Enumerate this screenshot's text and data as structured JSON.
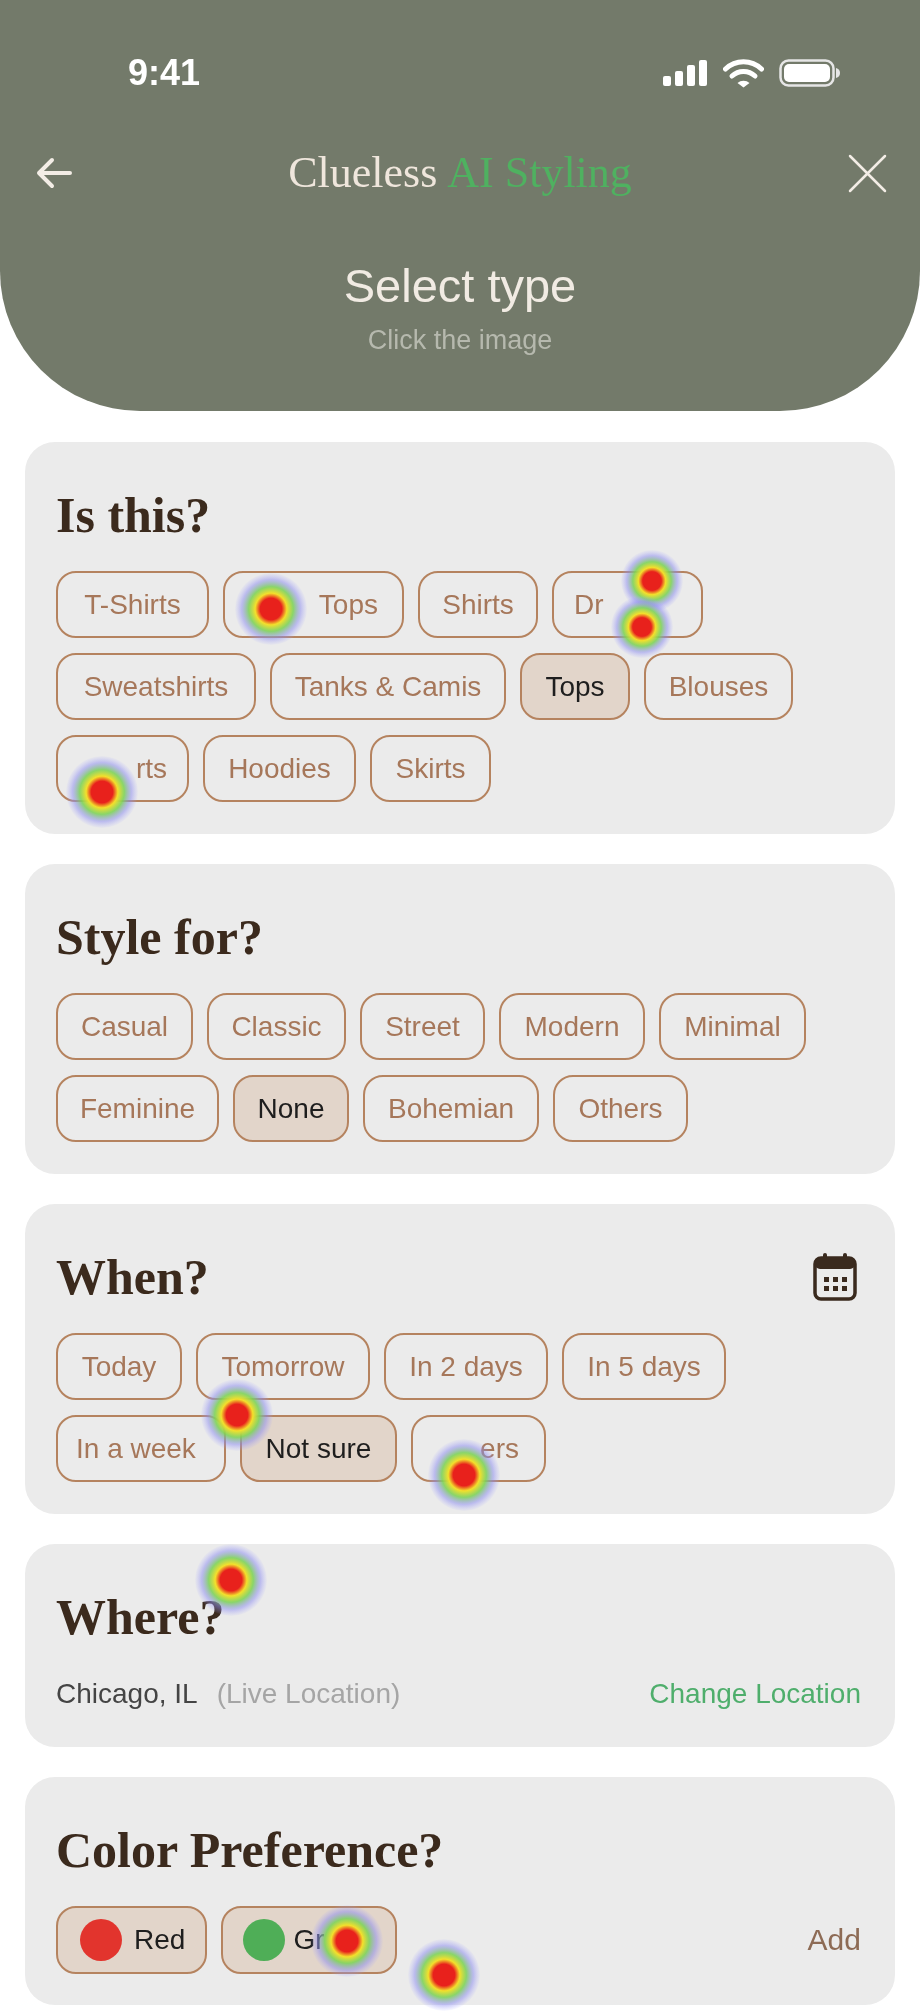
{
  "status_bar": {
    "time": "9:41"
  },
  "header": {
    "brand": "Clueless",
    "brand_accent": "AI Styling",
    "title": "Select type",
    "subtitle": "Click the image"
  },
  "sections": [
    {
      "kind": "choice",
      "heading": "Is this?",
      "options": [
        {
          "label": "T-Shirts",
          "selected": false
        },
        {
          "label": "Tops",
          "selected": false
        },
        {
          "label": "Shirts",
          "selected": false
        },
        {
          "label": "Dr",
          "selected": false
        },
        {
          "label": "Sweatshirts",
          "selected": false
        },
        {
          "label": "Tanks & Camis",
          "selected": false
        },
        {
          "label": "Tops",
          "selected": true
        },
        {
          "label": "Blouses",
          "selected": false
        },
        {
          "label": "rts",
          "selected": false
        },
        {
          "label": "Hoodies",
          "selected": false
        },
        {
          "label": "Skirts",
          "selected": false
        }
      ]
    },
    {
      "kind": "choice",
      "heading": "Style for?",
      "options": [
        {
          "label": "Casual",
          "selected": false
        },
        {
          "label": "Classic",
          "selected": false
        },
        {
          "label": "Street",
          "selected": false
        },
        {
          "label": "Modern",
          "selected": false
        },
        {
          "label": "Minimal",
          "selected": false
        },
        {
          "label": "Feminine",
          "selected": false
        },
        {
          "label": "None",
          "selected": true
        },
        {
          "label": "Bohemian",
          "selected": false
        },
        {
          "label": "Others",
          "selected": false
        }
      ]
    },
    {
      "kind": "date_choice",
      "heading": "When?",
      "options": [
        {
          "label": "Today",
          "selected": false
        },
        {
          "label": "Tomorrow",
          "selected": false
        },
        {
          "label": "In 2 days",
          "selected": false
        },
        {
          "label": "In 5 days",
          "selected": false
        },
        {
          "label": "In a week",
          "selected": false
        },
        {
          "label": "Not sure",
          "selected": true
        },
        {
          "label": "ers",
          "selected": false
        }
      ]
    },
    {
      "kind": "location",
      "heading": "Where?",
      "place": "Chicago, IL",
      "source": "(Live Location)",
      "action": "Change Location"
    },
    {
      "kind": "color_choice",
      "heading": "Color Preference?",
      "options": [
        {
          "label": "Red",
          "color": "#e2342d",
          "selected": true
        },
        {
          "label": "Gr",
          "color": "#4fae57",
          "selected": true
        }
      ],
      "action": "Add"
    }
  ]
}
